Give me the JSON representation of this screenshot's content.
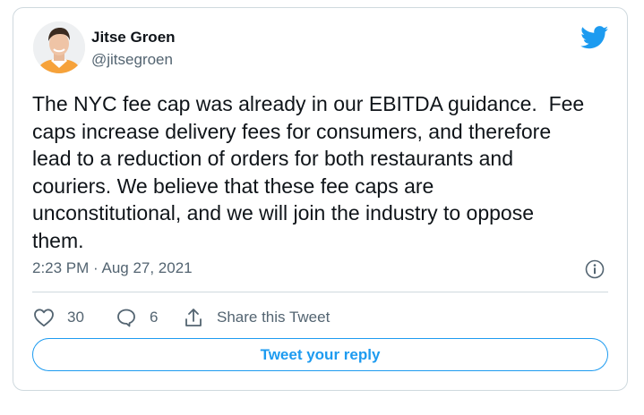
{
  "author": {
    "name": "Jitse Groen",
    "handle": "@jitsegroen"
  },
  "tweet": {
    "text": "The NYC fee cap was already in our EBITDA guidance.  Fee\ncaps increase delivery fees for consumers, and therefore\nlead to a reduction of orders for both restaurants and\ncouriers. We believe that these fee caps are\nunconstitutional, and we will join the industry to oppose\nthem.",
    "timestamp": "2:23 PM · Aug 27, 2021"
  },
  "actions": {
    "likes": "30",
    "replies": "6",
    "share_label": "Share this Tweet"
  },
  "reply_button": {
    "label": "Tweet your reply"
  },
  "icons": {
    "brand": "twitter-bird-icon",
    "info": "info-icon",
    "like": "heart-icon",
    "reply": "speech-bubble-icon",
    "share": "share-arrow-icon"
  },
  "colors": {
    "brand": "#1d9bf0",
    "text": "#0f1419",
    "secondary": "#536471",
    "border": "#cfd9de"
  }
}
